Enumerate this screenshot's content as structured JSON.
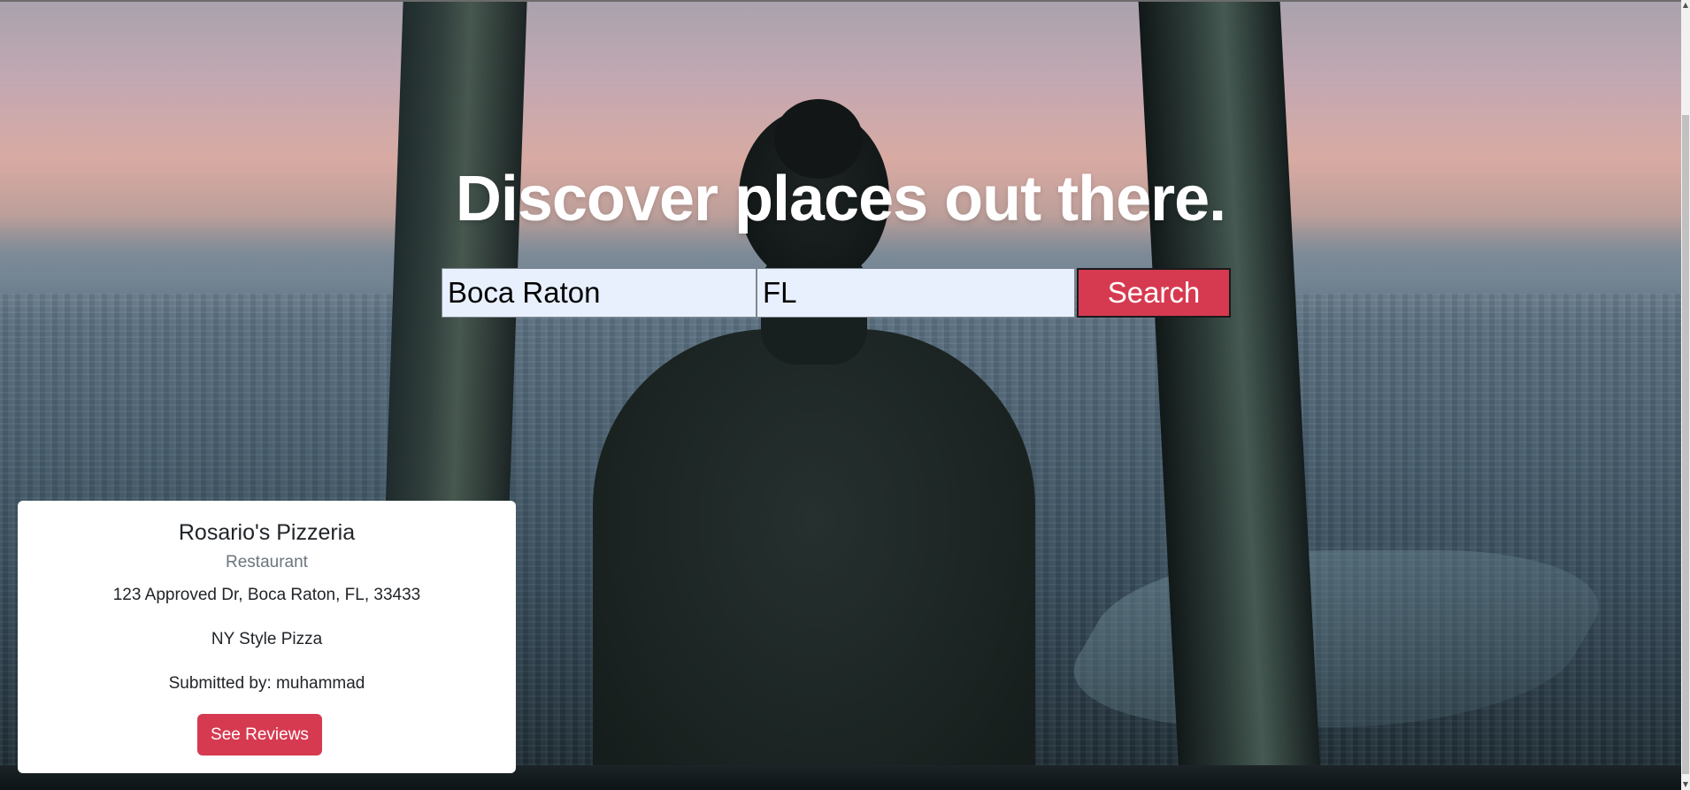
{
  "hero": {
    "title": "Discover places out there."
  },
  "search": {
    "city_value": "Boca Raton",
    "state_value": "FL",
    "button_label": "Search"
  },
  "result_card": {
    "name": "Rosario's Pizzeria",
    "category": "Restaurant",
    "address": "123 Approved Dr, Boca Raton, FL, 33433",
    "description": "NY Style Pizza",
    "submitted_by": "Submitted by: muhammad",
    "button_label": "See Reviews"
  },
  "colors": {
    "accent": "#d63a51",
    "input_bg": "#e8f0fe",
    "card_bg": "#ffffff",
    "muted_text": "#6c757d"
  },
  "icons": {
    "scroll_up": "scroll-up-arrow-icon",
    "scroll_down": "scroll-down-arrow-icon"
  }
}
